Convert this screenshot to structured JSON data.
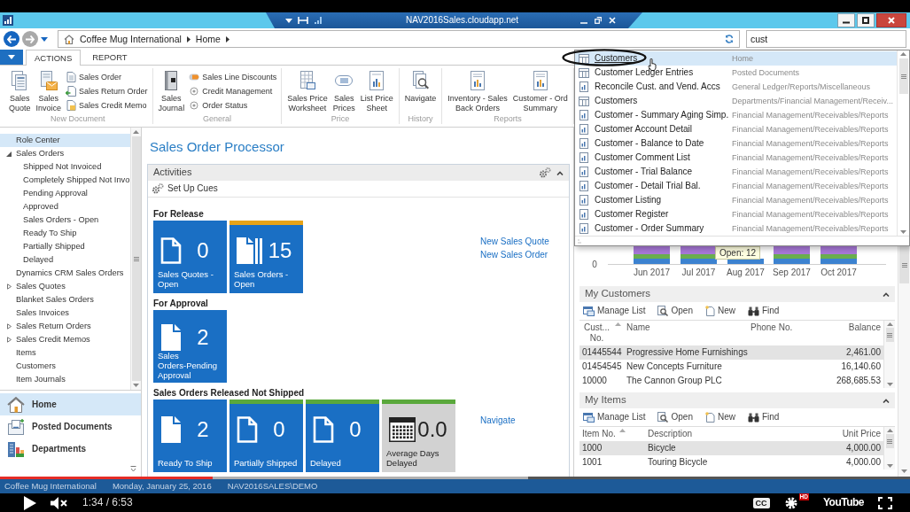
{
  "window": {
    "title": "NAV2016Sales.cloudapp.net"
  },
  "address_bar": {
    "breadcrumb": [
      "Coffee Mug International",
      "Home"
    ],
    "search": {
      "value": "cust"
    }
  },
  "ribbon": {
    "tabs": [
      {
        "label": "ACTIONS",
        "selected": true
      },
      {
        "label": "REPORT",
        "selected": false
      }
    ],
    "groups": [
      {
        "label": "New Document",
        "buttons": [
          {
            "kind": "large",
            "lines": [
              "Sales",
              "Quote"
            ]
          },
          {
            "kind": "large",
            "lines": [
              "Sales",
              "Invoice"
            ]
          },
          {
            "kind": "small",
            "lines": [
              "Sales Order"
            ]
          },
          {
            "kind": "small",
            "lines": [
              "Sales Return Order"
            ]
          },
          {
            "kind": "small",
            "lines": [
              "Sales Credit Memo"
            ]
          }
        ]
      },
      {
        "label": "General",
        "buttons": [
          {
            "kind": "large",
            "lines": [
              "Sales",
              "Journal"
            ]
          },
          {
            "kind": "small",
            "lines": [
              "Sales Line Discounts"
            ]
          },
          {
            "kind": "small",
            "lines": [
              "Credit Management"
            ]
          },
          {
            "kind": "small",
            "lines": [
              "Order Status"
            ]
          }
        ]
      },
      {
        "label": "Price",
        "buttons": [
          {
            "kind": "large",
            "lines": [
              "Sales Price",
              "Worksheet"
            ]
          },
          {
            "kind": "large",
            "lines": [
              "Sales",
              "Prices"
            ]
          },
          {
            "kind": "large",
            "lines": [
              "List Price",
              "Sheet"
            ]
          }
        ]
      },
      {
        "label": "History",
        "buttons": [
          {
            "kind": "large",
            "lines": [
              "Navigate"
            ]
          }
        ]
      },
      {
        "label": "Reports",
        "buttons": [
          {
            "kind": "large",
            "lines": [
              "Inventory - Sales",
              "Back Orders"
            ]
          },
          {
            "kind": "large",
            "lines": [
              "Customer - Ord",
              "Summary"
            ]
          }
        ]
      }
    ]
  },
  "navigation": {
    "tree": [
      {
        "label": "Role Center",
        "selected": true
      },
      {
        "label": "Sales Orders",
        "selected": false,
        "expanded": true,
        "children": [
          {
            "label": "Shipped Not Invoiced",
            "selected": false
          },
          {
            "label": "Completely Shipped Not Invo",
            "selected": false
          },
          {
            "label": "Pending Approval",
            "selected": false
          },
          {
            "label": "Approved",
            "selected": false
          },
          {
            "label": "Sales Orders - Open",
            "selected": false
          },
          {
            "label": "Ready To Ship",
            "selected": false
          },
          {
            "label": "Partially Shipped",
            "selected": false
          },
          {
            "label": "Delayed",
            "selected": false
          }
        ]
      },
      {
        "label": "Dynamics CRM Sales Orders",
        "selected": false
      },
      {
        "label": "Sales Quotes",
        "selected": false,
        "expanded": false
      },
      {
        "label": "Blanket Sales Orders",
        "selected": false
      },
      {
        "label": "Sales Invoices",
        "selected": false
      },
      {
        "label": "Sales Return Orders",
        "selected": false,
        "expanded": false
      },
      {
        "label": "Sales Credit Memos",
        "selected": false,
        "expanded": false
      },
      {
        "label": "Items",
        "selected": false
      },
      {
        "label": "Customers",
        "selected": false
      },
      {
        "label": "Item Journals",
        "selected": false
      }
    ],
    "buttons": [
      {
        "label": "Home",
        "selected": true
      },
      {
        "label": "Posted Documents",
        "selected": false
      },
      {
        "label": "Departments",
        "selected": false
      }
    ]
  },
  "page_title": "Sales Order Processor",
  "activities": {
    "title": "Activities",
    "actions": [
      "Set Up Cues"
    ],
    "groups": [
      {
        "title": "For Release",
        "tiles": [
          {
            "kind": "count",
            "label": "Sales Quotes - Open",
            "value": "0"
          },
          {
            "kind": "count",
            "label": "Sales Orders - Open",
            "value": "15",
            "color": "#e8a317"
          }
        ],
        "links": [
          "New Sales Quote",
          "New Sales Order"
        ]
      },
      {
        "title": "For Approval",
        "tiles": [
          {
            "kind": "count",
            "label": "Sales Orders-Pending Approval",
            "value": "2"
          }
        ]
      },
      {
        "title": "Sales Orders Released Not Shipped",
        "tiles": [
          {
            "kind": "count",
            "label": "Ready To Ship",
            "value": "2"
          },
          {
            "kind": "count",
            "label": "Partially Shipped",
            "value": "0",
            "color": "#5aa83c"
          },
          {
            "kind": "count",
            "label": "Delayed",
            "value": "0",
            "color": "#5aa83c"
          },
          {
            "kind": "average",
            "label": "Average Days Delayed",
            "value": "0.0",
            "color": "#5aa83c"
          }
        ],
        "links": [
          "Navigate"
        ]
      }
    ]
  },
  "chart": {
    "y_tick": "0",
    "months": [
      "Jun 2017",
      "Jul 2017",
      "Aug 2017",
      "Sep 2017",
      "Oct 2017"
    ],
    "tooltip": "Open: 12"
  },
  "my_customers": {
    "title": "My Customers",
    "actions": [
      "Manage List",
      "Open",
      "New",
      "Find"
    ],
    "columns": [
      {
        "label": "Cust... No.",
        "sorted": true
      },
      {
        "label": "Name",
        "sorted": false
      },
      {
        "label": "Phone No.",
        "sorted": false
      },
      {
        "label": "Balance",
        "sorted": false
      }
    ],
    "rows": [
      {
        "no": "01445544",
        "name": "Progressive Home Furnishings",
        "balance": "2,461.00",
        "selected": true
      },
      {
        "no": "01454545",
        "name": "New Concepts Furniture",
        "balance": "16,140.60",
        "selected": false
      },
      {
        "no": "10000",
        "name": "The Cannon Group PLC",
        "balance": "268,685.53",
        "selected": false
      }
    ]
  },
  "my_items": {
    "title": "My Items",
    "actions": [
      "Manage List",
      "Open",
      "New",
      "Find"
    ],
    "columns": [
      {
        "label": "Item No.",
        "sorted": true
      },
      {
        "label": "Description",
        "sorted": false
      },
      {
        "label": "Unit Price",
        "sorted": false
      }
    ],
    "rows": [
      {
        "no": "1000",
        "description": "Bicycle",
        "unit_price": "4,000.00",
        "selected": true
      },
      {
        "no": "1001",
        "description": "Touring Bicycle",
        "unit_price": "4,000.00",
        "selected": false
      }
    ]
  },
  "search_results": [
    {
      "kind": "list",
      "name": "Customers",
      "location": "Home",
      "selected": true
    },
    {
      "kind": "list",
      "name": "Customer Ledger Entries",
      "location": "Posted Documents",
      "selected": false
    },
    {
      "kind": "report",
      "name": "Reconcile Cust. and Vend. Accs",
      "location": "General Ledger/Reports/Miscellaneous",
      "selected": false
    },
    {
      "kind": "list",
      "name": "Customers",
      "location": "Departments/Financial Management/Receiv...",
      "selected": false
    },
    {
      "kind": "report",
      "name": "Customer - Summary Aging Simp.",
      "location": "Financial Management/Receivables/Reports",
      "selected": false
    },
    {
      "kind": "report",
      "name": "Customer Account Detail",
      "location": "Financial Management/Receivables/Reports",
      "selected": false
    },
    {
      "kind": "report",
      "name": "Customer - Balance to Date",
      "location": "Financial Management/Receivables/Reports",
      "selected": false
    },
    {
      "kind": "report",
      "name": "Customer Comment List",
      "location": "Financial Management/Receivables/Reports",
      "selected": false
    },
    {
      "kind": "report",
      "name": "Customer - Trial Balance",
      "location": "Financial Management/Receivables/Reports",
      "selected": false
    },
    {
      "kind": "report",
      "name": "Customer - Detail Trial Bal.",
      "location": "Financial Management/Receivables/Reports",
      "selected": false
    },
    {
      "kind": "report",
      "name": "Customer Listing",
      "location": "Financial Management/Receivables/Reports",
      "selected": false
    },
    {
      "kind": "report",
      "name": "Customer Register",
      "location": "Financial Management/Receivables/Reports",
      "selected": false
    },
    {
      "kind": "report",
      "name": "Customer - Order Summary",
      "location": "Financial Management/Receivables/Reports",
      "selected": false
    }
  ],
  "status_bar": [
    "Coffee Mug International",
    "Monday, January 25, 2016",
    "NAV2016SALES\\DEMO"
  ],
  "player": {
    "progress": {
      "level": 0.234
    },
    "buffered": {
      "level": 0.58
    },
    "muted": true,
    "time": "1:34 / 6:53",
    "captions": "CC",
    "quality": "HD",
    "logo": "YouTube"
  }
}
